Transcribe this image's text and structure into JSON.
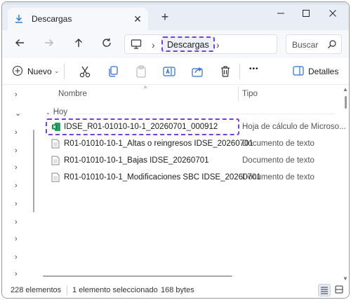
{
  "tab": {
    "title": "Descargas",
    "close_glyph": "✕",
    "icon": "download-icon"
  },
  "new_tab_glyph": "+",
  "address": {
    "crumb": "Descargas",
    "separator": "›"
  },
  "search": {
    "placeholder": "Buscar"
  },
  "command_bar": {
    "new_label": "Nuevo",
    "details_label": "Detalles",
    "more_glyph": "•••"
  },
  "columns": {
    "name": "Nombre",
    "type": "Tipo"
  },
  "group": {
    "label": "Hoy"
  },
  "files": [
    {
      "name": "IDSE_R01-01010-10-1_20260701_000912",
      "type": "Hoja de cálculo de Microso...",
      "icon": "excel-icon",
      "selected": true
    },
    {
      "name": "R01-01010-10-1_Altas o reingresos IDSE_20260701",
      "type": "Documento de texto",
      "icon": "text-document-icon",
      "selected": false
    },
    {
      "name": "R01-01010-10-1_Bajas IDSE_20260701",
      "type": "Documento de texto",
      "icon": "text-document-icon",
      "selected": false
    },
    {
      "name": "R01-01010-10-1_Modificaciones SBC IDSE_20260701",
      "type": "Documento de texto",
      "icon": "text-document-icon",
      "selected": false
    }
  ],
  "status": {
    "count": "228 elementos",
    "selection": "1 elemento seleccionado",
    "size": "168 bytes"
  },
  "colors": {
    "accent": "#7a3fd6",
    "tabbar": "#e9eef6",
    "excel": "#21a366"
  }
}
